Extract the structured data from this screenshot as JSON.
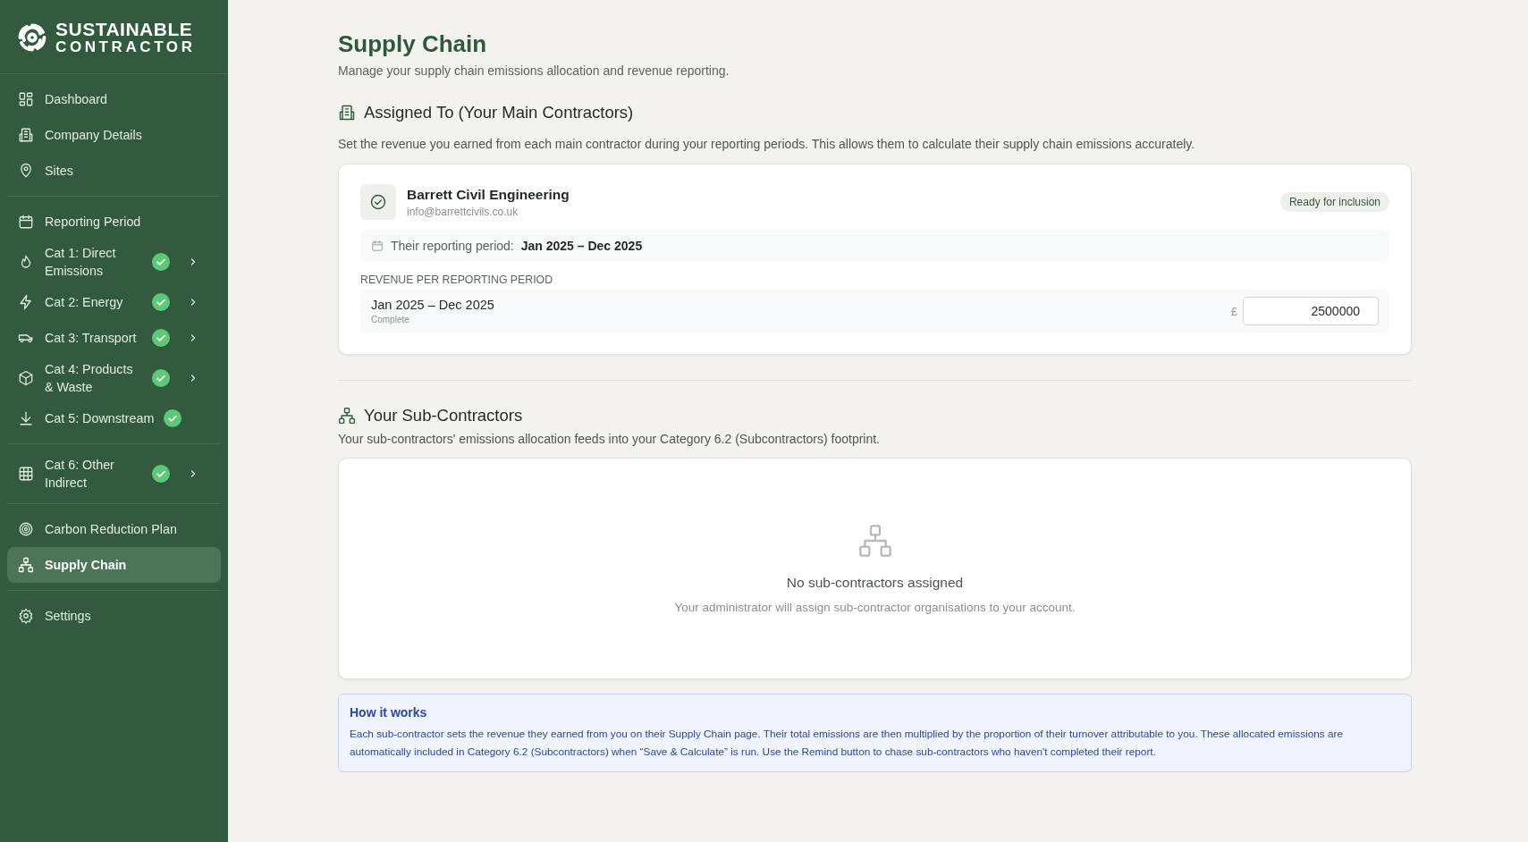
{
  "brand": {
    "line_1": "SUSTAINABLE",
    "line_2": "CONTRACTOR"
  },
  "sidebar": {
    "groups": [
      {
        "items": [
          {
            "label": "Dashboard",
            "selected": false,
            "complete": false,
            "has_submenu": false
          },
          {
            "label": "Company Details",
            "selected": false,
            "complete": false,
            "has_submenu": false
          },
          {
            "label": "Sites",
            "selected": false,
            "complete": false,
            "has_submenu": false
          }
        ]
      },
      {
        "items": [
          {
            "label": "Reporting Period",
            "selected": false,
            "complete": false,
            "has_submenu": false
          },
          {
            "label": "Cat 1: Direct Emissions",
            "selected": false,
            "complete": true,
            "has_submenu": true
          },
          {
            "label": "Cat 2: Energy",
            "selected": false,
            "complete": true,
            "has_submenu": true
          },
          {
            "label": "Cat 3: Transport",
            "selected": false,
            "complete": true,
            "has_submenu": true
          },
          {
            "label": "Cat 4: Products & Waste",
            "selected": false,
            "complete": true,
            "has_submenu": true
          },
          {
            "label": "Cat 5: Downstream",
            "selected": false,
            "complete": true,
            "has_submenu": false
          }
        ]
      },
      {
        "items": [
          {
            "label": "Cat 6: Other Indirect",
            "selected": false,
            "complete": true,
            "has_submenu": true
          }
        ]
      },
      {
        "items": [
          {
            "label": "Carbon Reduction Plan",
            "selected": false,
            "complete": false,
            "has_submenu": false
          },
          {
            "label": "Supply Chain",
            "selected": true,
            "complete": false,
            "has_submenu": false
          }
        ]
      },
      {
        "items": [
          {
            "label": "Settings",
            "selected": false,
            "complete": false,
            "has_submenu": false
          }
        ]
      }
    ]
  },
  "page": {
    "title": "Supply Chain",
    "subtitle": "Manage your supply chain emissions allocation and revenue reporting."
  },
  "assigned": {
    "heading": "Assigned To (Your Main Contractors)",
    "description": "Set the revenue you earned from each main contractor during your reporting periods. This allows them to calculate their supply chain emissions accurately.",
    "contractors": [
      {
        "name": "Barrett Civil Engineering",
        "email": "info@barrettcivils.co.uk",
        "status": "Ready for inclusion",
        "period_label": "Their reporting period:",
        "period": "Jan 2025 – Dec 2025",
        "revenue_label": "REVENUE PER REPORTING PERIOD",
        "periods": [
          {
            "period": "Jan 2025 – Dec 2025",
            "status": "Complete",
            "currency": "£",
            "value": "2500000"
          }
        ]
      }
    ]
  },
  "subcontractors": {
    "heading": "Your Sub-Contractors",
    "description": "Your sub-contractors' emissions allocation feeds into your Category 6.2 (Subcontractors) footprint.",
    "empty": {
      "title": "No sub-contractors assigned",
      "text": "Your administrator will assign sub-contractor organisations to your account."
    }
  },
  "how_it_works": {
    "title": "How it works",
    "text": "Each sub-contractor sets the revenue they earned from you on their Supply Chain page. Their total emissions are then multiplied by the proportion of their turnover attributable to you. These allocated emissions are automatically included in Category 6.2 (Subcontractors) when “Save & Calculate” is run. Use the Remind button to chase sub-contractors who haven't completed their report."
  }
}
